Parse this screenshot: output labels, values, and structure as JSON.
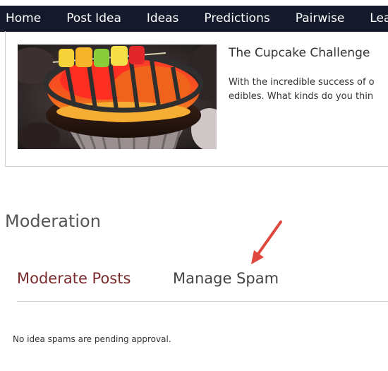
{
  "nav": {
    "items": [
      {
        "label": "Home"
      },
      {
        "label": "Post Idea"
      },
      {
        "label": "Ideas"
      },
      {
        "label": "Predictions"
      },
      {
        "label": "Pairwise"
      },
      {
        "label": "Lea"
      }
    ]
  },
  "idea": {
    "title": "The Cupcake Challenge",
    "description_line1": "With the incredible success of o",
    "description_line2": "edibles. What kinds do you thin"
  },
  "moderation": {
    "heading": "Moderation",
    "tabs": [
      {
        "label": "Moderate Posts",
        "color": "#7a2a2a"
      },
      {
        "label": "Manage Spam",
        "color": "#444444"
      }
    ],
    "empty_message": "No idea spams are pending approval."
  },
  "colors": {
    "nav_background": "#141a2c",
    "annotation_arrow": "#e0483e"
  }
}
